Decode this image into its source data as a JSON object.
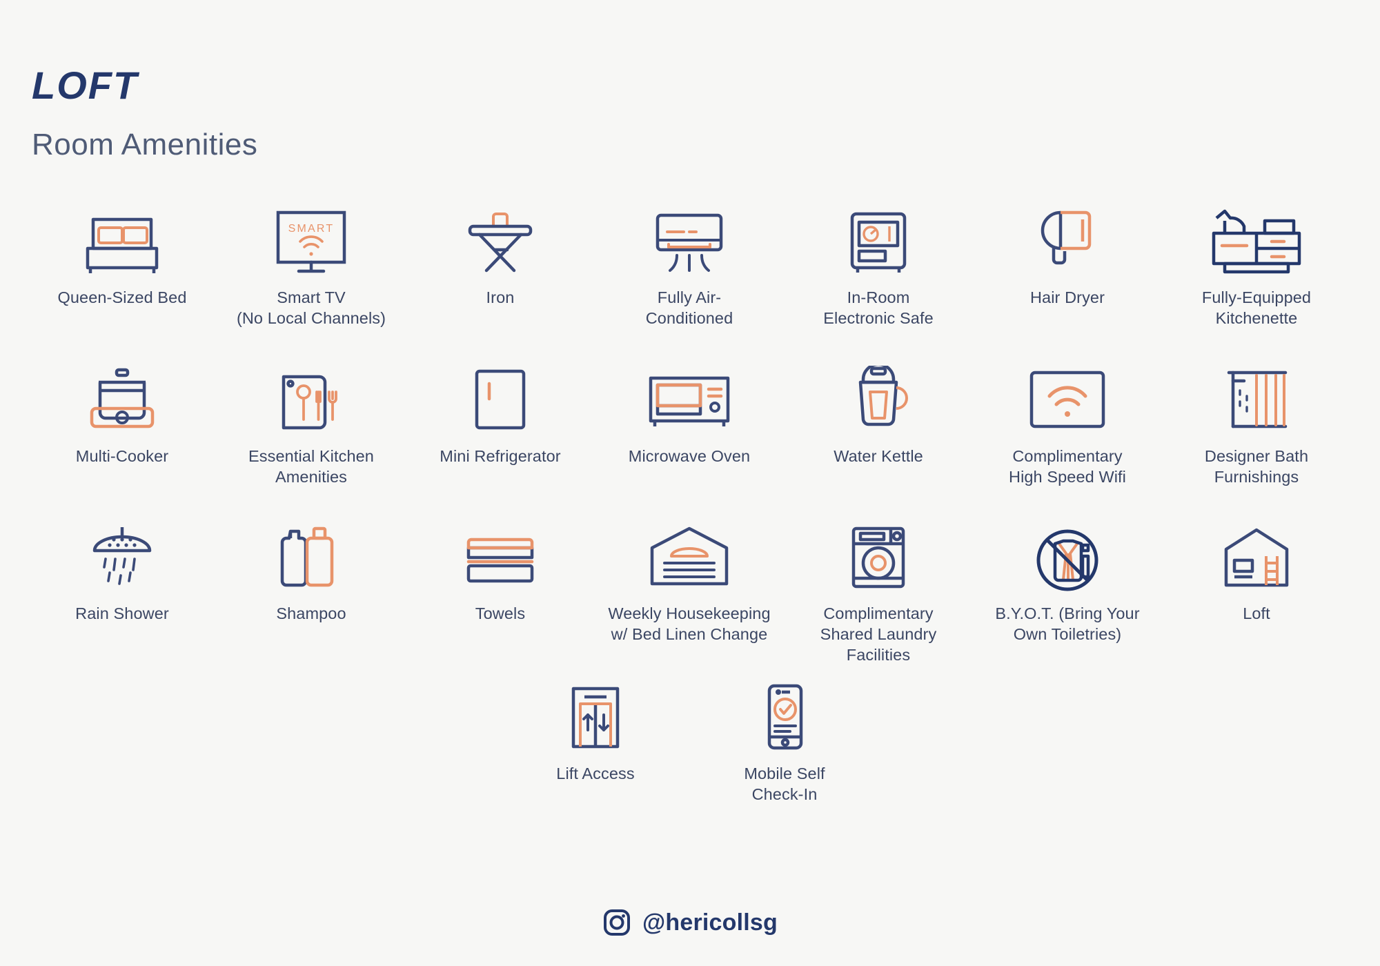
{
  "header": {
    "title": "LOFT",
    "subtitle": "Room Amenities"
  },
  "colors": {
    "background": "#f7f7f5",
    "navy": "#3b4a78",
    "navy_dark": "#24386b",
    "text": "#3b4663",
    "orange": "#e8936a",
    "orange_light": "#f0ab86"
  },
  "amenities": {
    "row1": [
      {
        "icon": "bed-icon",
        "label": "Queen-Sized Bed"
      },
      {
        "icon": "smart-tv-icon",
        "label": "Smart TV\n(No Local Channels)",
        "badge": "SMART"
      },
      {
        "icon": "iron-icon",
        "label": "Iron"
      },
      {
        "icon": "air-conditioner-icon",
        "label": "Fully Air-\nConditioned"
      },
      {
        "icon": "safe-icon",
        "label": "In-Room\nElectronic Safe"
      },
      {
        "icon": "hair-dryer-icon",
        "label": "Hair Dryer"
      },
      {
        "icon": "kitchenette-icon",
        "label": "Fully-Equipped\nKitchenette"
      }
    ],
    "row2": [
      {
        "icon": "multi-cooker-icon",
        "label": "Multi-Cooker"
      },
      {
        "icon": "cutlery-board-icon",
        "label": "Essential Kitchen\nAmenities"
      },
      {
        "icon": "mini-fridge-icon",
        "label": "Mini Refrigerator"
      },
      {
        "icon": "microwave-icon",
        "label": "Microwave Oven"
      },
      {
        "icon": "kettle-icon",
        "label": "Water Kettle"
      },
      {
        "icon": "wifi-icon",
        "label": "Complimentary\nHigh Speed Wifi"
      },
      {
        "icon": "shower-curtain-icon",
        "label": "Designer Bath\nFurnishings"
      }
    ],
    "row3": [
      {
        "icon": "rain-shower-icon",
        "label": "Rain Shower"
      },
      {
        "icon": "shampoo-bottles-icon",
        "label": "Shampoo"
      },
      {
        "icon": "towels-icon",
        "label": "Towels"
      },
      {
        "icon": "housekeeping-bed-icon",
        "label": "Weekly Housekeeping\nw/ Bed Linen Change"
      },
      {
        "icon": "washing-machine-icon",
        "label": "Complimentary\nShared Laundry\nFacilities"
      },
      {
        "icon": "no-toiletries-icon",
        "label": "B.Y.O.T. (Bring Your\nOwn Toiletries)"
      },
      {
        "icon": "loft-house-icon",
        "label": "Loft"
      }
    ],
    "row4": [
      {
        "icon": "lift-icon",
        "label": "Lift Access"
      },
      {
        "icon": "mobile-checkin-icon",
        "label": "Mobile Self\nCheck-In"
      }
    ]
  },
  "footer": {
    "icon": "instagram-icon",
    "handle": "@hericollsg"
  }
}
